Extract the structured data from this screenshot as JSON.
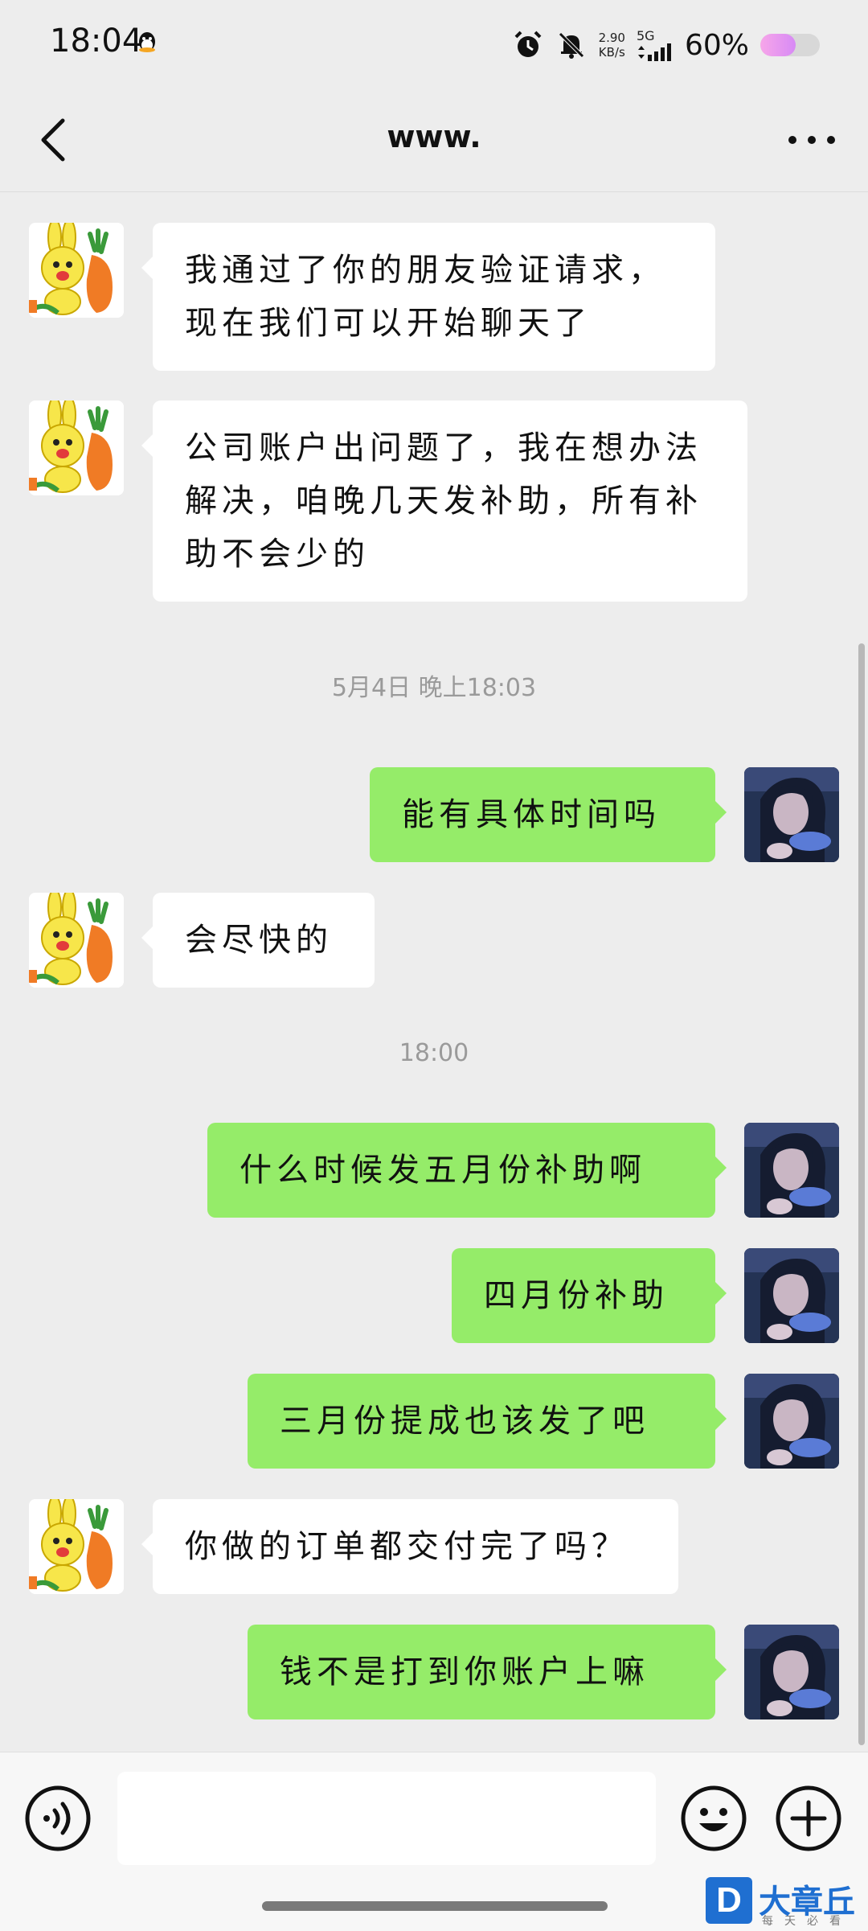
{
  "status_bar": {
    "time": "18:04",
    "net_speed_value": "2.90",
    "net_speed_unit": "KB/s",
    "network": "5G",
    "battery_text": "60%",
    "battery_level": 0.6
  },
  "nav": {
    "title": "www."
  },
  "messages": [
    {
      "side": "in",
      "text": "我通过了你的朋友验证请求，现在我们可以开始聊天了"
    },
    {
      "side": "in",
      "text": "公司账户出问题了，我在想办法解决，咱晚几天发补助，所有补助不会少的"
    },
    {
      "type": "time",
      "text": "5月4日 晚上18:03"
    },
    {
      "side": "out",
      "text": "能有具体时间吗"
    },
    {
      "side": "in",
      "text": "会尽快的"
    },
    {
      "type": "time",
      "text": "18:00"
    },
    {
      "side": "out",
      "text": "什么时候发五月份补助啊"
    },
    {
      "side": "out",
      "text": "四月份补助"
    },
    {
      "side": "out",
      "text": "三月份提成也该发了吧"
    },
    {
      "side": "in",
      "text": "你做的订单都交付完了吗？"
    },
    {
      "side": "out",
      "text": "钱不是打到你账户上嘛"
    }
  ],
  "input": {
    "placeholder": ""
  },
  "watermark": {
    "logo_letter": "D",
    "name": "大章丘",
    "slogan": "每天必看"
  },
  "colors": {
    "background": "#ededed",
    "outgoing_bubble": "#95ec69",
    "incoming_bubble": "#ffffff"
  }
}
